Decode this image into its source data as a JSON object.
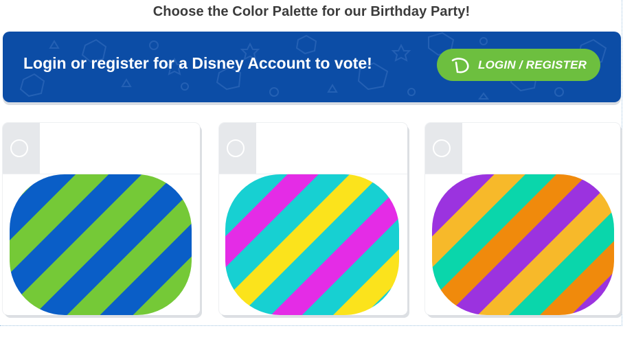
{
  "page": {
    "title": "Choose the Color Palette for our Birthday Party!"
  },
  "banner": {
    "message": "Login or register for a Disney Account to vote!",
    "button_label": "LOGIN / REGISTER",
    "background_color": "#0c4da6",
    "button_color": "#6dbf3f",
    "button_icon": "disney-d-logo-icon"
  },
  "options": [
    {
      "name": "palette-option-1",
      "selected": false,
      "stripe_colors": [
        "#75c937",
        "#0a5ec7"
      ]
    },
    {
      "name": "palette-option-2",
      "selected": false,
      "stripe_colors": [
        "#fbe31c",
        "#17d0d2",
        "#e42ce6",
        "#17d0d2"
      ]
    },
    {
      "name": "palette-option-3",
      "selected": false,
      "stripe_colors": [
        "#f08a0c",
        "#9b33df",
        "#f7b92a",
        "#0ad6ab"
      ]
    }
  ]
}
